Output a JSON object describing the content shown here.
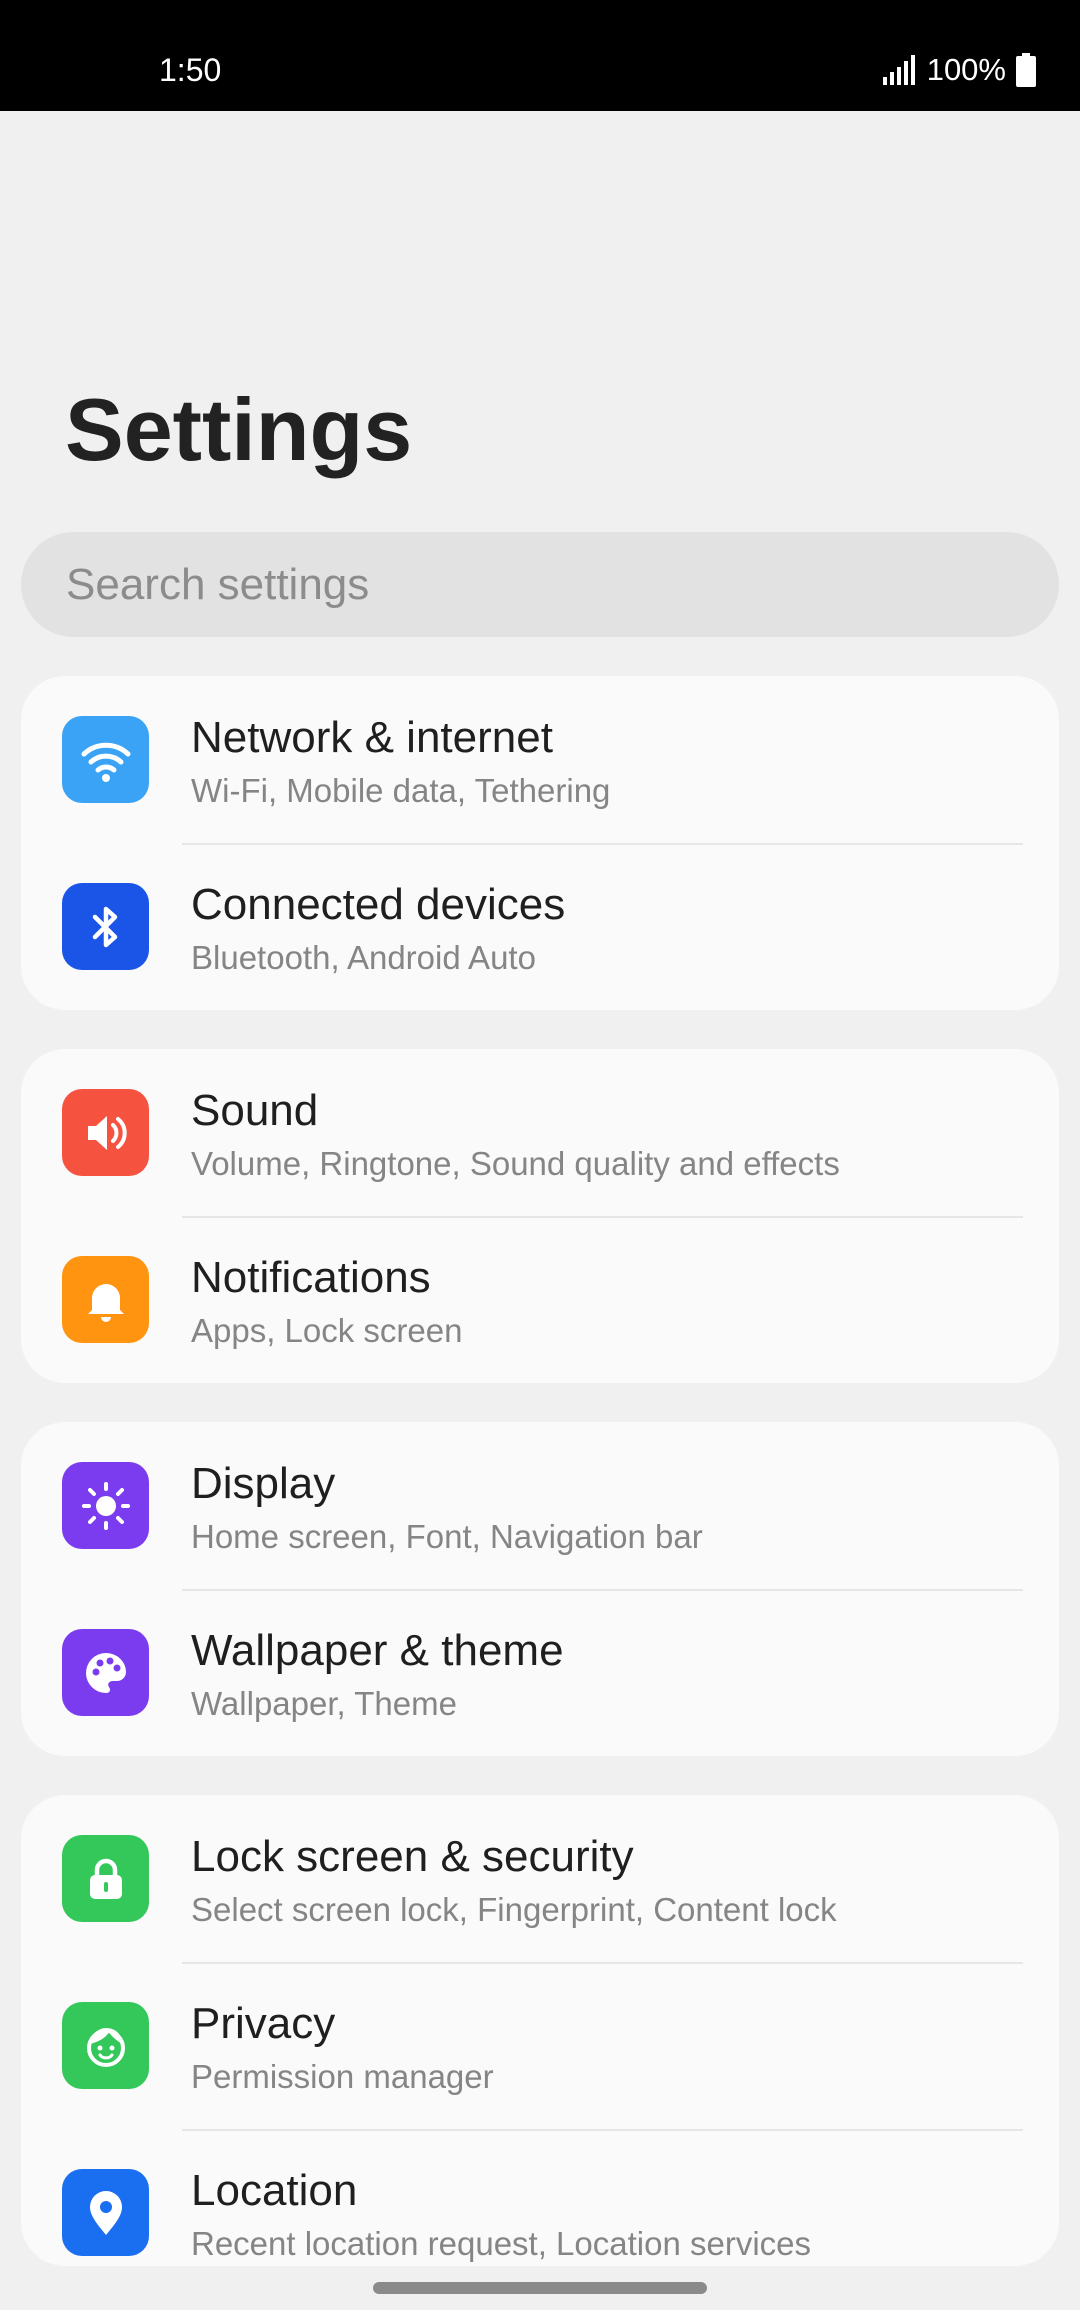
{
  "status_bar": {
    "time": "1:50",
    "battery": "100%"
  },
  "page": {
    "title": "Settings"
  },
  "search": {
    "placeholder": "Search settings"
  },
  "colors": {
    "network": "#3aa3f5",
    "connected": "#1a55e8",
    "sound": "#f5533f",
    "notifications": "#ff9410",
    "display": "#7b3cf0",
    "wallpaper": "#7b3cf0",
    "lock": "#34c759",
    "privacy": "#34c759",
    "location": "#1a6ff0"
  },
  "groups": [
    {
      "items": [
        {
          "title": "Network & internet",
          "subtitle": "Wi-Fi, Mobile data, Tethering",
          "icon": "wifi-icon"
        },
        {
          "title": "Connected devices",
          "subtitle": "Bluetooth, Android Auto",
          "icon": "bluetooth-icon"
        }
      ]
    },
    {
      "items": [
        {
          "title": "Sound",
          "subtitle": "Volume, Ringtone, Sound quality and effects",
          "icon": "speaker-icon"
        },
        {
          "title": "Notifications",
          "subtitle": "Apps, Lock screen",
          "icon": "bell-icon"
        }
      ]
    },
    {
      "items": [
        {
          "title": "Display",
          "subtitle": "Home screen, Font, Navigation bar",
          "icon": "brightness-icon"
        },
        {
          "title": "Wallpaper & theme",
          "subtitle": "Wallpaper, Theme",
          "icon": "palette-icon"
        }
      ]
    },
    {
      "items": [
        {
          "title": "Lock screen & security",
          "subtitle": "Select screen lock, Fingerprint, Content lock",
          "icon": "lock-icon"
        },
        {
          "title": "Privacy",
          "subtitle": "Permission manager",
          "icon": "privacy-face-icon"
        },
        {
          "title": "Location",
          "subtitle": "Recent location request, Location services",
          "icon": "location-pin-icon"
        }
      ]
    }
  ]
}
